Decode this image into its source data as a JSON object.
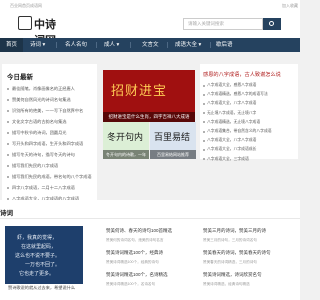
{
  "topbar": {
    "left_text": "百业网首页成语网",
    "right_text": "加入收藏"
  },
  "header": {
    "logo_text": "中诗词网",
    "search_placeholder": "请输入关键词搜索"
  },
  "nav": {
    "items": [
      {
        "label": "首页",
        "active": true
      },
      {
        "label": "诗词 ▾"
      },
      {
        "label": "名人名句"
      },
      {
        "label": "成人 ▾"
      },
      {
        "label": "文言文"
      },
      {
        "label": "成语大全 ▾"
      },
      {
        "label": "歇后语"
      }
    ]
  },
  "today": {
    "title": "今日最新",
    "items": [
      "最佳随笔，肖像画像名的正经唐人",
      "赞美何自然风光的诗词名句集选",
      "识别所有的绝美，一一写下自然界中名",
      "文化文字古语的古韵名句集选",
      "描写中秋节的诗词，团圆月光",
      "写开头和四字成语，生开头和四字成语",
      "描写冬天的诗句，描写冬天的诗句",
      "描写我们先民的八字成语",
      "描写我们先民的成语，带名句的八个字成语",
      "四字八字成语，二月十二八字成语",
      "八字成语大全，八字成语的八字成语",
      "八字成语，八字成语大全集合成语",
      "八字成语大全，最新的八字成语集合"
    ]
  },
  "banner": {
    "text": "招财进宝",
    "caption": "招财进宝是什么生肖，四字吉祥八大成语"
  },
  "thumbs": [
    {
      "text": "冬开句内",
      "caption": "冬开句内的诗歌，一年"
    },
    {
      "text": "百里易结",
      "caption": "百里易结网站推荐"
    }
  ],
  "right_card": {
    "title": "感恩的八字成语，古人致谢怎么说",
    "items": [
      "八字成语大全，感恩八字成语",
      "八字成语精选，感恩八字的成语写法",
      "八字成语大全，八字八字成语",
      "无止境八字成语，无止境八字",
      "八字成语精选，无止境八字成语",
      "八字成语集合，带自然含义的八字成语",
      "八字成语大全，八字八字成语",
      "八字成语大全，八字成语成长",
      "八字成语大全，三字成语"
    ]
  },
  "poems": {
    "title": "诗词",
    "image_lines": [
      "虾，我真的觉得，",
      "在这就里起码，",
      "这么也不说不要子。",
      "一万也不回了。",
      "它也走了更多。"
    ],
    "image_caption": "赞诗歌说的就从过去来，希望说什么"
  },
  "entries": [
    {
      "h": "赞美何诗、春天的诗句100首精选",
      "d": "赞美何的诗词名句，绝美的诗句名言"
    },
    {
      "h": "赞美诗词精选100个，经典诗",
      "d": "赞美诗词精选100个，经典的诗句"
    },
    {
      "h": "赞美诗词精选100个，名诗精选",
      "d": "赞美诗词精选100个，名诗名句"
    },
    {
      "h": "赞美三月的诗词，赞美三月的诗",
      "d": "赞美三月的诗句，三月的诗词名句"
    },
    {
      "h": "赞美春天的诗词，赞美春天的诗句",
      "d": "赞美春天的诗词精选，三月的诗句"
    },
    {
      "h": "赞美诗词精选，诗词欣赏名句",
      "d": "赞美诗词精选，经典诗句精选"
    }
  ]
}
